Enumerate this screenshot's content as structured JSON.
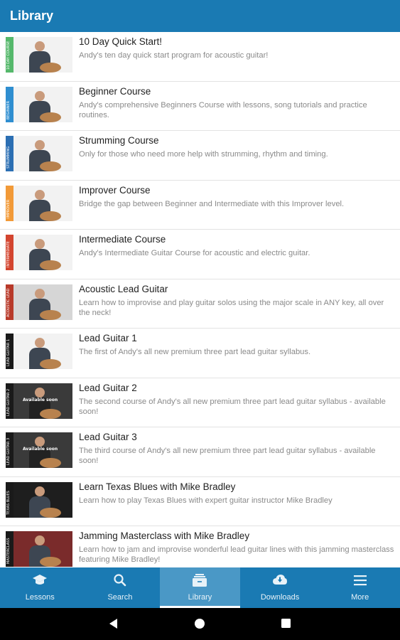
{
  "app_bar": {
    "title": "Library"
  },
  "courses": [
    {
      "title": "10 Day Quick Start!",
      "description": "Andy's ten day quick start program for acoustic guitar!",
      "thumb_color": "#55b86b",
      "thumb_label": "10 DAY COURSE",
      "thumb_style": "light"
    },
    {
      "title": "Beginner Course",
      "description": "Andy's comprehensive Beginners Course with lessons, song tutorials and practice routines.",
      "thumb_color": "#2f8ed0",
      "thumb_label": "BEGINNER",
      "thumb_style": "light"
    },
    {
      "title": "Strumming Course",
      "description": "Only for those who need more help with strumming, rhythm and timing.",
      "thumb_color": "#2c6fb3",
      "thumb_label": "STRUMMING",
      "thumb_style": "light"
    },
    {
      "title": "Improver Course",
      "description": "Bridge the gap between Beginner and Intermediate with this Improver level.",
      "thumb_color": "#f29a38",
      "thumb_label": "IMPROVER",
      "thumb_style": "light"
    },
    {
      "title": "Intermediate Course",
      "description": "Andy's Intermediate Guitar Course for acoustic and electric guitar.",
      "thumb_color": "#d3452f",
      "thumb_label": "INTERMEDIATE",
      "thumb_style": "light"
    },
    {
      "title": "Acoustic Lead Guitar",
      "description": "Learn how to improvise and play guitar solos using the major scale in ANY key, all over the neck!",
      "thumb_color": "#b83a2a",
      "thumb_label": "ACOUSTIC LEAD",
      "thumb_style": "grey"
    },
    {
      "title": "Lead Guitar 1",
      "description": "The first of Andy's all new premium three part lead guitar syllabus.",
      "thumb_color": "#1a1a1a",
      "thumb_label": "LEAD GUITAR 1",
      "thumb_style": "light"
    },
    {
      "title": "Lead Guitar 2",
      "description": "The second course of Andy's all new premium three part lead guitar syllabus - available soon!",
      "thumb_color": "#1a1a1a",
      "thumb_label": "LEAD GUITAR 2",
      "thumb_style": "dark",
      "overlay": "Available soon"
    },
    {
      "title": "Lead Guitar 3",
      "description": "The third course of Andy's all new premium three part lead guitar syllabus - available soon!",
      "thumb_color": "#1a1a1a",
      "thumb_label": "LEAD GUITAR 3",
      "thumb_style": "dark",
      "overlay": "Available soon"
    },
    {
      "title": "Learn Texas Blues with Mike Bradley",
      "description": "Learn how to play Texas Blues with expert guitar instructor Mike Bradley",
      "thumb_color": "#1a1a1a",
      "thumb_label": "TEXAS BLUES",
      "thumb_style": "black"
    },
    {
      "title": "Jamming Masterclass with Mike Bradley",
      "description": "Learn how to jam and improvise wonderful lead guitar lines with this jamming masterclass featuring Mike Bradley!",
      "thumb_color": "#1a1a1a",
      "thumb_label": "MASTERCLASS",
      "thumb_style": "red"
    }
  ],
  "bottom_nav": [
    {
      "label": "Lessons",
      "icon": "graduation-cap-icon",
      "active": false
    },
    {
      "label": "Search",
      "icon": "search-icon",
      "active": false
    },
    {
      "label": "Library",
      "icon": "library-icon",
      "active": true
    },
    {
      "label": "Downloads",
      "icon": "cloud-download-icon",
      "active": false
    },
    {
      "label": "More",
      "icon": "menu-icon",
      "active": false
    }
  ],
  "colors": {
    "primary": "#1a7ab3",
    "active_tab": "#4a98c6"
  }
}
